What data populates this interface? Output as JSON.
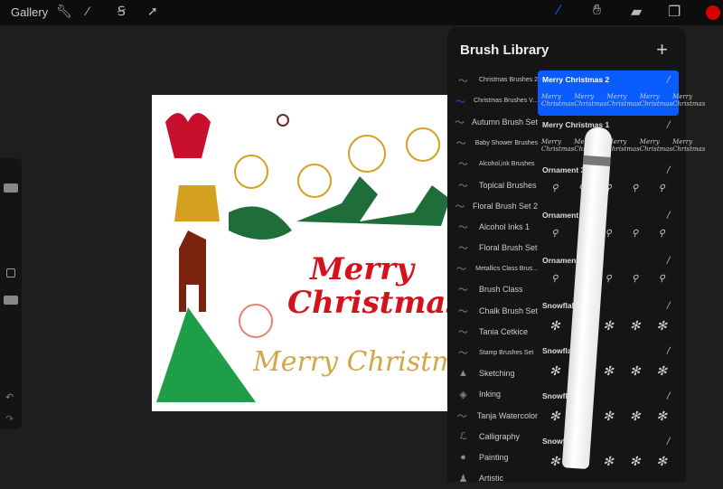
{
  "topbar": {
    "gallery": "Gallery",
    "tools": [
      "wrench-icon",
      "magic-wand-icon",
      "selection-icon",
      "transform-arrow-icon"
    ],
    "right_tools": [
      "brush-icon",
      "smudge-icon",
      "eraser-icon",
      "layers-icon",
      "color-swatch"
    ],
    "color": "#d40000",
    "accent": "#1a5cff"
  },
  "library": {
    "title": "Brush Library",
    "add": "+",
    "sets": [
      "Christmas Brushes 2",
      "Christmas Brushes V...",
      "Autumn Brush Set",
      "Baby Shower Brushes",
      "Alcohol,ink Brushes",
      "Topical Brushes",
      "Floral Brush Set 2",
      "Alcohol Inks 1",
      "Floral Brush Set",
      "Metallics Class Brus...",
      "Brush Class",
      "Chalk Brush Set",
      "Tania Cetkice",
      "Stamp Brushes Set",
      "Sketching",
      "Inking",
      "Tanja Watercolor",
      "Calligraphy",
      "Painting",
      "Artistic"
    ],
    "active_set": 1,
    "brushes": [
      "Merry Christmas 2",
      "Merry Christmas 1",
      "Ornament 3",
      "Ornament 2",
      "Ornament 1",
      "Snowflake 5",
      "Snowflake 4",
      "Snowflake 3",
      "Snowflake"
    ],
    "selected_brush": 0,
    "sample_text": "Merry Christmas"
  },
  "canvas": {
    "text1": "Merry",
    "text2": "Christmas",
    "text3": "Merry Christmas"
  }
}
